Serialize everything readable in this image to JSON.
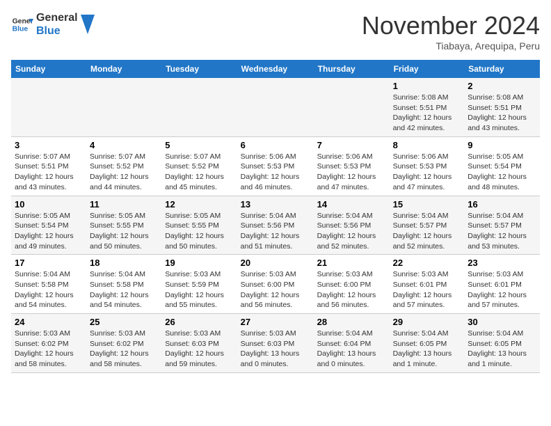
{
  "header": {
    "logo_line1": "General",
    "logo_line2": "Blue",
    "month": "November 2024",
    "location": "Tiabaya, Arequipa, Peru"
  },
  "weekdays": [
    "Sunday",
    "Monday",
    "Tuesday",
    "Wednesday",
    "Thursday",
    "Friday",
    "Saturday"
  ],
  "weeks": [
    [
      {
        "day": "",
        "info": ""
      },
      {
        "day": "",
        "info": ""
      },
      {
        "day": "",
        "info": ""
      },
      {
        "day": "",
        "info": ""
      },
      {
        "day": "",
        "info": ""
      },
      {
        "day": "1",
        "info": "Sunrise: 5:08 AM\nSunset: 5:51 PM\nDaylight: 12 hours\nand 42 minutes."
      },
      {
        "day": "2",
        "info": "Sunrise: 5:08 AM\nSunset: 5:51 PM\nDaylight: 12 hours\nand 43 minutes."
      }
    ],
    [
      {
        "day": "3",
        "info": "Sunrise: 5:07 AM\nSunset: 5:51 PM\nDaylight: 12 hours\nand 43 minutes."
      },
      {
        "day": "4",
        "info": "Sunrise: 5:07 AM\nSunset: 5:52 PM\nDaylight: 12 hours\nand 44 minutes."
      },
      {
        "day": "5",
        "info": "Sunrise: 5:07 AM\nSunset: 5:52 PM\nDaylight: 12 hours\nand 45 minutes."
      },
      {
        "day": "6",
        "info": "Sunrise: 5:06 AM\nSunset: 5:53 PM\nDaylight: 12 hours\nand 46 minutes."
      },
      {
        "day": "7",
        "info": "Sunrise: 5:06 AM\nSunset: 5:53 PM\nDaylight: 12 hours\nand 47 minutes."
      },
      {
        "day": "8",
        "info": "Sunrise: 5:06 AM\nSunset: 5:53 PM\nDaylight: 12 hours\nand 47 minutes."
      },
      {
        "day": "9",
        "info": "Sunrise: 5:05 AM\nSunset: 5:54 PM\nDaylight: 12 hours\nand 48 minutes."
      }
    ],
    [
      {
        "day": "10",
        "info": "Sunrise: 5:05 AM\nSunset: 5:54 PM\nDaylight: 12 hours\nand 49 minutes."
      },
      {
        "day": "11",
        "info": "Sunrise: 5:05 AM\nSunset: 5:55 PM\nDaylight: 12 hours\nand 50 minutes."
      },
      {
        "day": "12",
        "info": "Sunrise: 5:05 AM\nSunset: 5:55 PM\nDaylight: 12 hours\nand 50 minutes."
      },
      {
        "day": "13",
        "info": "Sunrise: 5:04 AM\nSunset: 5:56 PM\nDaylight: 12 hours\nand 51 minutes."
      },
      {
        "day": "14",
        "info": "Sunrise: 5:04 AM\nSunset: 5:56 PM\nDaylight: 12 hours\nand 52 minutes."
      },
      {
        "day": "15",
        "info": "Sunrise: 5:04 AM\nSunset: 5:57 PM\nDaylight: 12 hours\nand 52 minutes."
      },
      {
        "day": "16",
        "info": "Sunrise: 5:04 AM\nSunset: 5:57 PM\nDaylight: 12 hours\nand 53 minutes."
      }
    ],
    [
      {
        "day": "17",
        "info": "Sunrise: 5:04 AM\nSunset: 5:58 PM\nDaylight: 12 hours\nand 54 minutes."
      },
      {
        "day": "18",
        "info": "Sunrise: 5:04 AM\nSunset: 5:58 PM\nDaylight: 12 hours\nand 54 minutes."
      },
      {
        "day": "19",
        "info": "Sunrise: 5:03 AM\nSunset: 5:59 PM\nDaylight: 12 hours\nand 55 minutes."
      },
      {
        "day": "20",
        "info": "Sunrise: 5:03 AM\nSunset: 6:00 PM\nDaylight: 12 hours\nand 56 minutes."
      },
      {
        "day": "21",
        "info": "Sunrise: 5:03 AM\nSunset: 6:00 PM\nDaylight: 12 hours\nand 56 minutes."
      },
      {
        "day": "22",
        "info": "Sunrise: 5:03 AM\nSunset: 6:01 PM\nDaylight: 12 hours\nand 57 minutes."
      },
      {
        "day": "23",
        "info": "Sunrise: 5:03 AM\nSunset: 6:01 PM\nDaylight: 12 hours\nand 57 minutes."
      }
    ],
    [
      {
        "day": "24",
        "info": "Sunrise: 5:03 AM\nSunset: 6:02 PM\nDaylight: 12 hours\nand 58 minutes."
      },
      {
        "day": "25",
        "info": "Sunrise: 5:03 AM\nSunset: 6:02 PM\nDaylight: 12 hours\nand 58 minutes."
      },
      {
        "day": "26",
        "info": "Sunrise: 5:03 AM\nSunset: 6:03 PM\nDaylight: 12 hours\nand 59 minutes."
      },
      {
        "day": "27",
        "info": "Sunrise: 5:03 AM\nSunset: 6:03 PM\nDaylight: 13 hours\nand 0 minutes."
      },
      {
        "day": "28",
        "info": "Sunrise: 5:04 AM\nSunset: 6:04 PM\nDaylight: 13 hours\nand 0 minutes."
      },
      {
        "day": "29",
        "info": "Sunrise: 5:04 AM\nSunset: 6:05 PM\nDaylight: 13 hours\nand 1 minute."
      },
      {
        "day": "30",
        "info": "Sunrise: 5:04 AM\nSunset: 6:05 PM\nDaylight: 13 hours\nand 1 minute."
      }
    ]
  ]
}
